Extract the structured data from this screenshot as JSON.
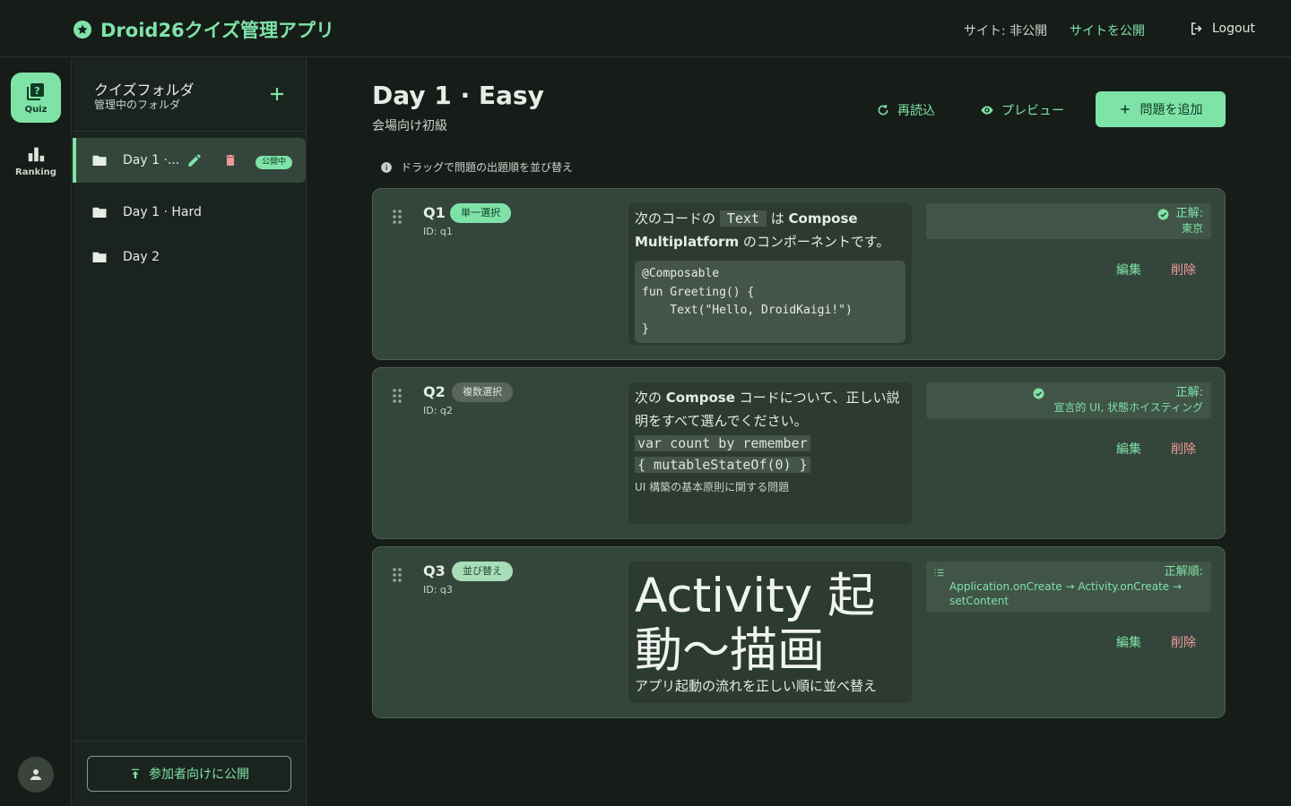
{
  "header": {
    "title": "Droid26クイズ管理アプリ",
    "site_status": "サイト: 非公開",
    "publish_site": "サイトを公開",
    "logout": "Logout"
  },
  "rail": {
    "quiz_label": "Quiz",
    "ranking_label": "Ranking"
  },
  "folders": {
    "title": "クイズフォルダ",
    "subtitle": "管理中のフォルダ",
    "items": [
      {
        "name": "Day 1 ·...",
        "badge": "公開中",
        "active": true
      },
      {
        "name": "Day 1 · Hard"
      },
      {
        "name": "Day 2"
      }
    ],
    "publish_button": "参加者向けに公開"
  },
  "main": {
    "title": "Day 1 · Easy",
    "subtitle": "会場向け初級",
    "reload": "再読込",
    "preview": "プレビュー",
    "add_question": "問題を追加",
    "hint": "ドラッグで問題の出題順を並び替え"
  },
  "questions": [
    {
      "num": "Q1",
      "type": "単一選択",
      "id": "ID: q1",
      "text_before": "次のコードの",
      "inline_code": "Text",
      "text_mid": "は",
      "text_bold": "Compose Multiplatform",
      "text_after": "のコンポーネントです。",
      "code": "@Composable\nfun Greeting() {\n    Text(\"Hello, DroidKaigi!\")\n}",
      "answer_label": "正解:",
      "answer_value": "東京",
      "edit": "編集",
      "delete": "削除"
    },
    {
      "num": "Q2",
      "type": "複数選択",
      "id": "ID: q2",
      "text_before": "次の",
      "text_bold": "Compose",
      "text_after": "コードについて、正しい説明をすべて選んでください。",
      "code_line1": "var count by remember",
      "code_line2": "{ mutableStateOf(0) }",
      "desc": "UI 構築の基本原則に関する問題",
      "answer_label": "正解:",
      "answer_value": "宣言的 UI, 状態ホイスティング",
      "edit": "編集",
      "delete": "削除"
    },
    {
      "num": "Q3",
      "type": "並び替え",
      "id": "ID: q3",
      "heading": "Activity 起動～描画",
      "desc": "アプリ起動の流れを正しい順に並べ替え",
      "answer_label": "正解順:",
      "answer_value": "Application.onCreate → Activity.onCreate → setContent",
      "edit": "編集",
      "delete": "削除"
    }
  ],
  "colors": {
    "accent": "#7fe3a8",
    "background": "#161d19",
    "card": "#34463b",
    "danger": "#ef9a9a"
  }
}
